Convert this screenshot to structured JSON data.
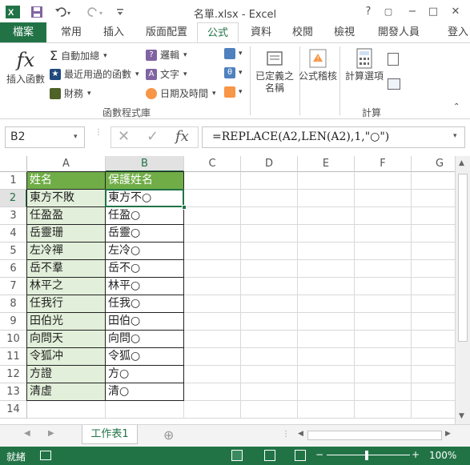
{
  "window": {
    "title": "名單.xlsx - Excel",
    "help": "?",
    "minimize": "−",
    "maximize": "□",
    "close": "✕",
    "restore": "▢"
  },
  "tabs": [
    "檔案",
    "常用",
    "插入",
    "版面配置",
    "公式",
    "資料",
    "校閱",
    "檢視",
    "開發人員",
    "登入"
  ],
  "ribbon": {
    "insert_function": "插入函數",
    "autosum": "自動加總",
    "recent": "最近用過的函數",
    "financial": "財務",
    "logical": "邏輯",
    "text": "文字",
    "datetime": "日期及時間",
    "defined_names": "已定義之\n名稱",
    "formula_auditing": "公式稽核",
    "calc_options": "計算選項",
    "group_library": "函數程式庫",
    "group_calc": "計算",
    "colors": {
      "logical": "#8064a2",
      "text": "#f79646",
      "datetime": "#c0504d",
      "financial": "#4f6228",
      "recent": "#1f497d"
    }
  },
  "formula_bar": {
    "name_box": "B2",
    "formula": "=REPLACE(A2,LEN(A2),1,\"○\")"
  },
  "columns": [
    "A",
    "B",
    "C",
    "D",
    "E",
    "F",
    "G"
  ],
  "rows": [
    "1",
    "2",
    "3",
    "4",
    "5",
    "6",
    "7",
    "8",
    "9",
    "10",
    "11",
    "12",
    "13",
    "14"
  ],
  "table": {
    "header_a": "姓名",
    "header_b": "保護姓名",
    "names": [
      "東方不敗",
      "任盈盈",
      "岳靈珊",
      "左冷禪",
      "岳不羣",
      "林平之",
      "任我行",
      "田伯光",
      "向問天",
      "令狐冲",
      "方證",
      "清虛"
    ],
    "masked": [
      "東方不○",
      "任盈○",
      "岳靈○",
      "左冷○",
      "岳不○",
      "林平○",
      "任我○",
      "田伯○",
      "向問○",
      "令狐○",
      "方○",
      "清○"
    ]
  },
  "sheet": {
    "tab": "工作表1",
    "add": "⊕"
  },
  "status": {
    "ready": "就緒",
    "zoom": "100%",
    "zoom_minus": "−",
    "zoom_plus": "+"
  },
  "accent": "#217346"
}
